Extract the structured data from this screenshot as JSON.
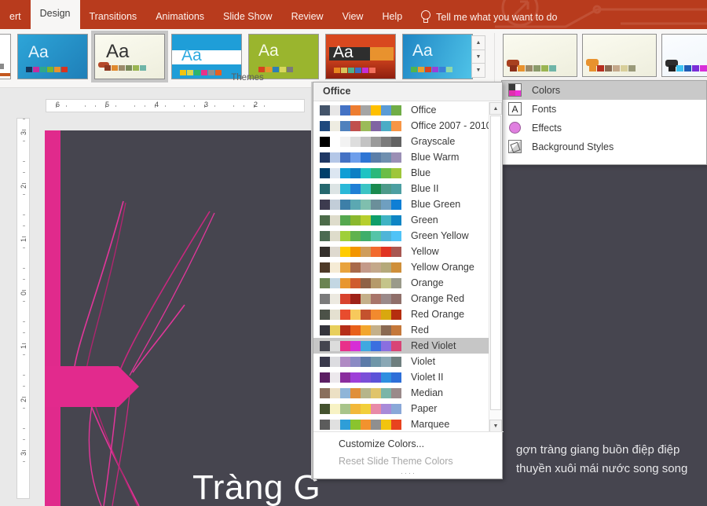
{
  "ribbon": {
    "tabs": [
      {
        "label": "ert",
        "active": false
      },
      {
        "label": "Design",
        "active": true
      },
      {
        "label": "Transitions",
        "active": false
      },
      {
        "label": "Animations",
        "active": false
      },
      {
        "label": "Slide Show",
        "active": false
      },
      {
        "label": "Review",
        "active": false
      },
      {
        "label": "View",
        "active": false
      },
      {
        "label": "Help",
        "active": false
      }
    ],
    "tell_me": "Tell me what you want to do",
    "tell_me_icon": "lightbulb-icon",
    "accent_color": "#b83b1d"
  },
  "themes_group": {
    "label": "Themes",
    "scroll_up_icon": "▲",
    "scroll_down_icon": "▼",
    "scroll_more_icon": "▼",
    "thumbnails": [
      {
        "name": "theme-white",
        "aa": "",
        "selected": false
      },
      {
        "name": "theme-facet-blue",
        "aa": "Aa",
        "selected": false
      },
      {
        "name": "theme-wisp",
        "aa": "Aa",
        "selected": true
      },
      {
        "name": "theme-banded",
        "aa": "Aa",
        "selected": false
      },
      {
        "name": "theme-green",
        "aa": "Aa",
        "selected": false
      },
      {
        "name": "theme-badge-orange",
        "aa": "Aa",
        "selected": false
      },
      {
        "name": "theme-circuit-blue",
        "aa": "Aa",
        "selected": false
      }
    ]
  },
  "variants_group": {
    "thumbnails": [
      "variant-1",
      "variant-2",
      "variant-3"
    ]
  },
  "colors_dropdown": {
    "header": "Office",
    "selected": "Red Violet",
    "items": [
      {
        "label": "Office",
        "colors": [
          "#44546a",
          "#e7e6e6",
          "#4472c4",
          "#ed7d31",
          "#a5a5a5",
          "#ffc000",
          "#5b9bd5",
          "#70ad47"
        ]
      },
      {
        "label": "Office 2007 - 2010",
        "colors": [
          "#1f497d",
          "#eeece1",
          "#4f81bd",
          "#c0504d",
          "#9bbb59",
          "#8064a2",
          "#4bacc6",
          "#f79646"
        ]
      },
      {
        "label": "Grayscale",
        "colors": [
          "#000000",
          "#ffffff",
          "#f2f2f2",
          "#dddddd",
          "#c3c3c3",
          "#9a9a9a",
          "#7b7b7b",
          "#636363"
        ]
      },
      {
        "label": "Blue Warm",
        "colors": [
          "#1f3864",
          "#b4c7e7",
          "#4472c4",
          "#6d9eeb",
          "#2e75d4",
          "#5b7ea8",
          "#6f8faf",
          "#9b8fb5"
        ]
      },
      {
        "label": "Blue",
        "colors": [
          "#003f6b",
          "#dce6f1",
          "#0f9ed5",
          "#0d7fc4",
          "#1fc3c3",
          "#2cb87a",
          "#6bbd45",
          "#9fc63a"
        ]
      },
      {
        "label": "Blue II",
        "colors": [
          "#25686f",
          "#dce4e4",
          "#2ab8d8",
          "#1f7fd5",
          "#3cc4c4",
          "#1a8a4e",
          "#4d9a8a",
          "#4c9fa2"
        ]
      },
      {
        "label": "Blue Green",
        "colors": [
          "#3d3b4f",
          "#c2cdd8",
          "#3d7fa8",
          "#5ba8b2",
          "#7fbfae",
          "#6b8f9a",
          "#6f9fc0",
          "#0f7fd5"
        ]
      },
      {
        "label": "Green",
        "colors": [
          "#4c6b49",
          "#dedccb",
          "#55a84f",
          "#8bb82e",
          "#b7cf2e",
          "#0f9e6a",
          "#3fb3c4",
          "#0f85c4"
        ]
      },
      {
        "label": "Green Yellow",
        "colors": [
          "#4c6b52",
          "#dedccb",
          "#9fcf3a",
          "#5fb24f",
          "#3fae6a",
          "#55c4a8",
          "#4fb5d8",
          "#4fc3f7"
        ]
      },
      {
        "label": "Yellow",
        "colors": [
          "#34302c",
          "#ded9cf",
          "#ffcc00",
          "#f29500",
          "#cf9d5c",
          "#f26a2e",
          "#e03423",
          "#a85852"
        ]
      },
      {
        "label": "Yellow Orange",
        "colors": [
          "#4e3a28",
          "#f5ebd5",
          "#e8a33d",
          "#a8694a",
          "#c49a8a",
          "#c4a88a",
          "#b5a97a",
          "#cf8f3a"
        ]
      },
      {
        "label": "Orange",
        "colors": [
          "#6b8452",
          "#c3d7e3",
          "#e8962e",
          "#cf5c2e",
          "#8f6246",
          "#b59a6a",
          "#c4c48a",
          "#9a9a8a"
        ]
      },
      {
        "label": "Orange Red",
        "colors": [
          "#7b7b7b",
          "#ece9e0",
          "#d8432e",
          "#9e2218",
          "#c4b08a",
          "#a8756a",
          "#9a8a8a",
          "#8f6f6a"
        ]
      },
      {
        "label": "Red Orange",
        "colors": [
          "#4c5248",
          "#e4e0d0",
          "#e84c2e",
          "#f7c95c",
          "#c4522e",
          "#f28a2e",
          "#d8a80f",
          "#b52e0f"
        ]
      },
      {
        "label": "Red",
        "colors": [
          "#34343c",
          "#e8cf5c",
          "#b52e18",
          "#e8601a",
          "#f2a62e",
          "#c4b08a",
          "#8a6a52",
          "#c4783a"
        ]
      },
      {
        "label": "Red Violet",
        "colors": [
          "#44454f",
          "#dcdcdc",
          "#e8318a",
          "#d62ed6",
          "#3fa8e0",
          "#3a6fe0",
          "#8a6fe0",
          "#d84476"
        ]
      },
      {
        "label": "Violet",
        "colors": [
          "#3a3a4c",
          "#dcdce0",
          "#b08ac4",
          "#8a8ac4",
          "#5c7ba8",
          "#6f96a8",
          "#8aa8b5",
          "#6f7f7f"
        ]
      },
      {
        "label": "Violet II",
        "colors": [
          "#5c1f63",
          "#ece8ec",
          "#8a2e9e",
          "#9e3fd8",
          "#7a4fd8",
          "#5c52d8",
          "#2e8fe0",
          "#2e6fd8"
        ]
      },
      {
        "label": "Median",
        "colors": [
          "#8a6f5c",
          "#ece0c4",
          "#8fb5d8",
          "#e08f3a",
          "#b5b58a",
          "#e0c46a",
          "#7ab5a8",
          "#9a8a8a"
        ]
      },
      {
        "label": "Paper",
        "colors": [
          "#44522e",
          "#f7f2c4",
          "#a8c48a",
          "#f2b83a",
          "#f2cf3a",
          "#e88aa8",
          "#a88ad8",
          "#8aa8d8"
        ]
      },
      {
        "label": "Marquee",
        "colors": [
          "#5c5c5c",
          "#e0e0e0",
          "#2e9ed8",
          "#8ac42e",
          "#f2922e",
          "#8f8f8f",
          "#f2c40f",
          "#e8431f"
        ]
      }
    ],
    "footer": {
      "customize": "Customize Colors...",
      "reset": "Reset Slide Theme Colors",
      "grip": "····"
    },
    "scroll_up_icon": "▲",
    "scroll_down_icon": "▼"
  },
  "right_menu": {
    "items": [
      {
        "label": "Colors",
        "icon": "colors-icon",
        "highlighted": true
      },
      {
        "label": "Fonts",
        "icon": "fonts-icon",
        "highlighted": false
      },
      {
        "label": "Effects",
        "icon": "effects-icon",
        "highlighted": false
      },
      {
        "label": "Background Styles",
        "icon": "background-styles-icon",
        "highlighted": false
      }
    ]
  },
  "rulers": {
    "horizontal_labels": [
      "6",
      "5",
      "4",
      "3",
      "2"
    ],
    "vertical_labels": [
      "3",
      "2",
      "1",
      "0",
      "1",
      "2",
      "3"
    ]
  },
  "slide": {
    "title": "Tràng G",
    "body_line1": "gợn tràng giang buồn điệp điệp",
    "body_line2": "thuyền xuôi mái nước song song",
    "background_color": "#46454f",
    "accent_color": "#e02a8c"
  }
}
